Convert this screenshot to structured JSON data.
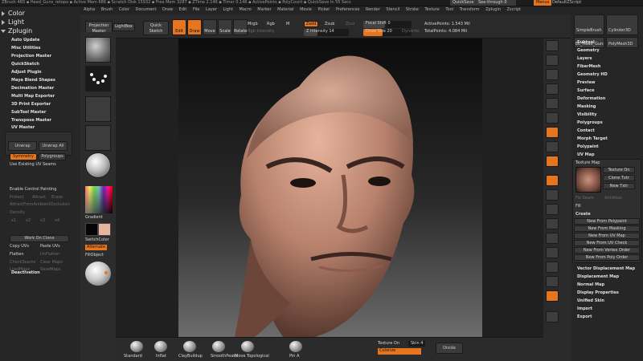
{
  "titlebar": {
    "text": "ZBrush 4R5 ▪ Head_Guns_retopo ▪ Active Mem 686 ▪ Scratch Disk 15932 ▪ Free Mem 3287 ▪ ZTime 2.146 ▪ Timer 0.146 ▪ ActivePoints ▪ PolyCount ▪ QuickSave In 55 Secs",
    "quicksave": "QuickSave",
    "seethrough": "See-through 0",
    "menus_label": "Menus",
    "defaultscript": "DefaultZScript"
  },
  "menubar": [
    "Alpha",
    "Brush",
    "Color",
    "Document",
    "Draw",
    "Edit",
    "File",
    "Layer",
    "Light",
    "Macro",
    "Marker",
    "Material",
    "Movie",
    "Picker",
    "Preferences",
    "Render",
    "Stencil",
    "Stroke",
    "Texture",
    "Tool",
    "Transform",
    "Zplugin",
    "Zscript"
  ],
  "toolbar": {
    "projection_master": "Projection Master",
    "lightbox": "LightBox",
    "quick_sketch": "Quick Sketch",
    "edit": "Edit",
    "draw": "Draw",
    "move": "Move",
    "scale": "Scale",
    "rotate": "Rotate",
    "mrgb": "Mrgb",
    "rgb": "Rgb",
    "m": "M",
    "rgb_intensity": "Rgb Intensity",
    "zadd": "Zadd",
    "zsub": "Zsub",
    "zcut": "Zcut",
    "z_intensity": "Z Intensity 14",
    "focal_shift": "Focal Shift 0",
    "draw_size": "Draw Size 20",
    "dynamic": "Dynamic",
    "active_points": "ActivePoints: 1.543 Mil",
    "total_points": "TotalPoints: 4.084 Mil"
  },
  "left_panel": {
    "headers": [
      "Color",
      "Light",
      "Zplugin"
    ],
    "plugins": [
      "Auto Update",
      "Misc Utilities",
      "Projection Master",
      "QuickSketch",
      "Adjust Plugin",
      "Maya Blend Shapes",
      "Decimation Master",
      "Multi Map Exporter",
      "3D Print Exporter",
      "SubTool Master",
      "Transpose Master"
    ],
    "uv_master": "UV Master",
    "unwrap": "Unwrap",
    "unwrap_all": "Unwrap All",
    "symmetry": "Symmetry",
    "polygroups": "Polygroups",
    "use_existing_uv": "Use Existing UV Seams",
    "enable_control_painting": "Enable Control Painting",
    "protect": "Protect",
    "attract": "Attract",
    "erase": "Erase",
    "attract_ambient": "AttractFromAmbientOcclusion",
    "density": "Density",
    "density_values": [
      "x1",
      "x2",
      "x3",
      "x4"
    ],
    "work_on_clone": "Work On Clone",
    "copy_uvs": "Copy UVs",
    "paste_uvs": "Paste UVs",
    "flatten": "Flatten",
    "unflatten": "UnFlatten",
    "check_seams": "CheckSeams",
    "clear_maps": "Clear Maps",
    "load_maps": "LoadMaps",
    "save_maps": "SaveMaps",
    "deactivation": "Deactivation"
  },
  "brush_col": {
    "gradient": "Gradient",
    "switch_color": "SwitchColor",
    "alternate": "Alternate",
    "fill_object": "FillObject"
  },
  "bottom_bar": {
    "brushes": [
      "Standard",
      "Inflat",
      "ClayBuildup",
      "SmoothPeaks",
      "Move Topological",
      "Pin A"
    ],
    "texture_on": "Texture On",
    "colorize": "Colorize",
    "skin": "Skin 4",
    "divide": "Divide"
  },
  "right_col_icons": [
    "bpr-icon",
    "spix-icon",
    "scroll-icon",
    "zoom-icon",
    "actual-icon",
    "aahalf-icon",
    "persp-icon",
    "floor-icon",
    "local-icon",
    "lsym-icon",
    "xyz-icon",
    "frame-icon",
    "move-icon",
    "scale-icon",
    "rotate-icon",
    "polyf-icon",
    "transp-icon",
    "solo-icon",
    "xpose-icon"
  ],
  "right_panel": {
    "top_buttons": [
      "SimpleBrush",
      "Cylinder3D",
      "EL_Head_Guns_retopo",
      "PolyMesh3D"
    ],
    "items": [
      "Subtool",
      "Geometry",
      "Layers",
      "FiberMesh",
      "Geometry HD",
      "Preview",
      "Surface",
      "Deformation",
      "Masking",
      "Visibility",
      "Polygroups",
      "Contact",
      "Morph Target",
      "Polypaint",
      "UV Map"
    ],
    "texture_map": "Texture Map",
    "texture_on": "Texture On",
    "clone_txtr": "Clone Txtr",
    "new_txtr": "New Txtr",
    "fix_seam": "Fix Seam",
    "antialias": "AntiAlias",
    "fill": "Fill",
    "create": "Create",
    "create_buttons": [
      "New From Polypaint",
      "New From Masking",
      "New From UV Map",
      "New From UV Check",
      "New From Vertex Order",
      "New From Poly Order"
    ],
    "bottom_items": [
      "Vector Displacement Map",
      "Displacement Map",
      "Normal Map",
      "Display Properties",
      "Unified Skin",
      "Import",
      "Export"
    ]
  },
  "colors": {
    "accent": "#e6751f",
    "panel": "#262626",
    "skin": "#c8907a"
  }
}
